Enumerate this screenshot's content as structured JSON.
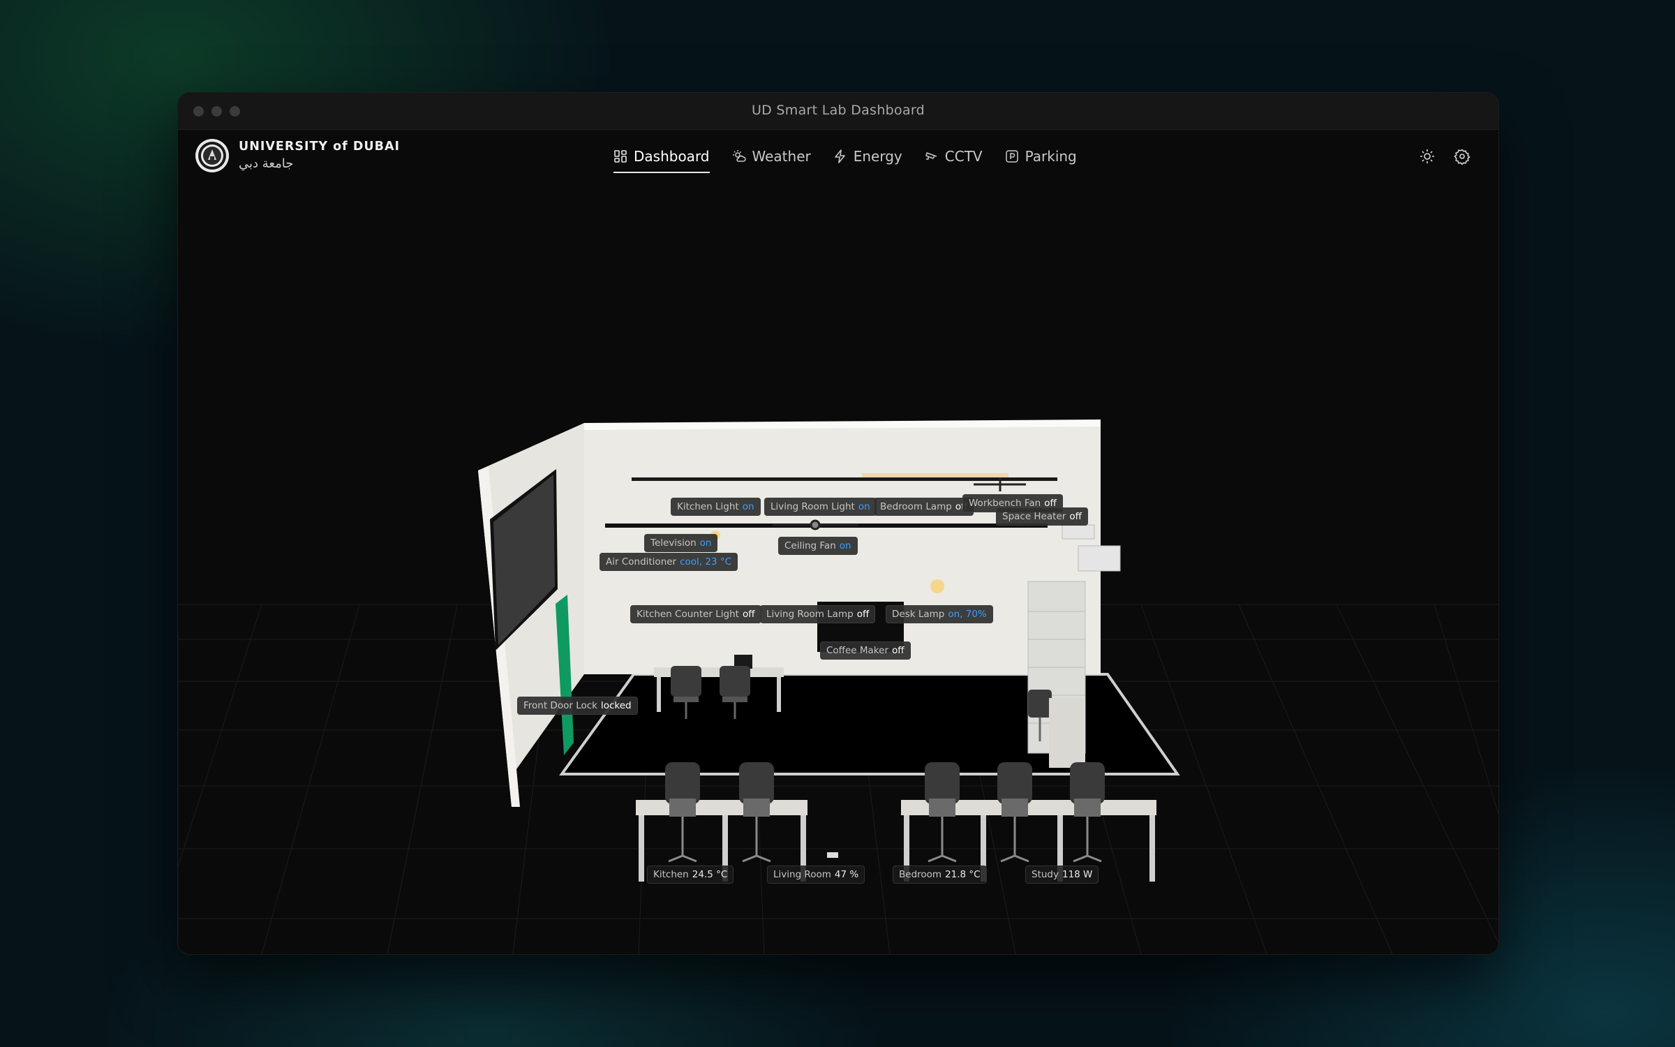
{
  "window": {
    "title": "UD Smart Lab Dashboard"
  },
  "brand": {
    "name_en": "UNIVERSITY of DUBAI",
    "name_ar": "جامعة دبي"
  },
  "nav": [
    {
      "label": "Dashboard",
      "icon": "dashboard-grid-icon",
      "active": true
    },
    {
      "label": "Weather",
      "icon": "weather-sun-cloud-icon",
      "active": false
    },
    {
      "label": "Energy",
      "icon": "lightning-bolt-icon",
      "active": false
    },
    {
      "label": "CCTV",
      "icon": "cctv-camera-icon",
      "active": false
    },
    {
      "label": "Parking",
      "icon": "parking-sign-icon",
      "active": false
    }
  ],
  "toolbar": {
    "theme_icon": "sun-icon",
    "settings_icon": "gear-icon"
  },
  "devices": {
    "kitchen_light": {
      "name": "Kitchen Light",
      "state": "on"
    },
    "living_room_light": {
      "name": "Living Room Light",
      "state": "on"
    },
    "bedroom_lamp": {
      "name": "Bedroom Lamp",
      "state": "off"
    },
    "workbench_fan": {
      "name": "Workbench Fan",
      "state": "off"
    },
    "space_heater": {
      "name": "Space Heater",
      "state": "off"
    },
    "television": {
      "name": "Television",
      "state": "on"
    },
    "ceiling_fan": {
      "name": "Ceiling Fan",
      "state": "on"
    },
    "air_conditioner": {
      "name": "Air Conditioner",
      "state": "cool, 23 °C"
    },
    "kitchen_counter_light": {
      "name": "Kitchen Counter Light",
      "state": "off"
    },
    "living_room_lamp": {
      "name": "Living Room Lamp",
      "state": "off"
    },
    "desk_lamp": {
      "name": "Desk Lamp",
      "state": "on, 70%"
    },
    "coffee_maker": {
      "name": "Coffee Maker",
      "state": "off"
    },
    "front_door_lock": {
      "name": "Front Door Lock",
      "state": "locked"
    }
  },
  "sensors": {
    "kitchen": {
      "name": "Kitchen",
      "value": "24.5 °C"
    },
    "living_room": {
      "name": "Living Room",
      "value": "47 %"
    },
    "bedroom": {
      "name": "Bedroom",
      "value": "21.8 °C"
    },
    "study": {
      "name": "Study",
      "value": "118 W"
    }
  },
  "colors": {
    "active_state": "#3aa0ff",
    "accent_green": "#0f9a62"
  }
}
